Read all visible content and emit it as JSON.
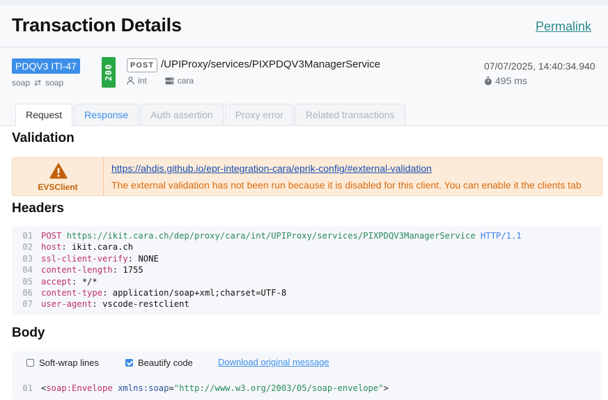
{
  "header": {
    "title": "Transaction Details",
    "permalink": "Permalink"
  },
  "summary": {
    "profile": "PDQV3 ITI-47",
    "proto_in": "soap",
    "proto_arrow": "⇄",
    "proto_out": "soap",
    "status": "200",
    "method": "POST",
    "path": "/UPIProxy/services/PIXPDQV3ManagerService",
    "user": "int",
    "server": "cara",
    "datetime": "07/07/2025, 14:40:34.940",
    "duration": "495 ms",
    "colors": {
      "badge": "#3c8ee8",
      "status_ok": "#28a745"
    }
  },
  "tabs": [
    {
      "label": "Request",
      "state": "active"
    },
    {
      "label": "Response",
      "state": "link"
    },
    {
      "label": "Auth assertion",
      "state": "disabled"
    },
    {
      "label": "Proxy error",
      "state": "disabled"
    },
    {
      "label": "Related transactions",
      "state": "disabled"
    }
  ],
  "validation": {
    "title": "Validation",
    "source": "EVSClient",
    "url": "https://ahdis.github.io/epr-integration-cara/eprik-config/#external-validation",
    "message": "The external validation has not been run because it is disabled for this client. You can enable it the clients tab"
  },
  "headers": {
    "title": "Headers",
    "lines": [
      {
        "n": "01",
        "method": "POST",
        "url": "https://ikit.cara.ch/dep/proxy/cara/int/UPIProxy/services/PIXPDQV3ManagerService",
        "proto": "HTTP/1.1"
      },
      {
        "n": "02",
        "key": "host",
        "value": "ikit.cara.ch"
      },
      {
        "n": "03",
        "key": "ssl-client-verify",
        "value": "NONE"
      },
      {
        "n": "04",
        "key": "content-length",
        "value": "1755"
      },
      {
        "n": "05",
        "key": "accept",
        "value": "*/*"
      },
      {
        "n": "06",
        "key": "content-type",
        "value": "application/soap+xml;charset=UTF-8"
      },
      {
        "n": "07",
        "key": "user-agent",
        "value": "vscode-restclient"
      }
    ]
  },
  "body": {
    "title": "Body",
    "soft_wrap_label": "Soft-wrap lines",
    "soft_wrap_checked": false,
    "beautify_label": "Beautify code",
    "beautify_checked": true,
    "download_label": "Download original message",
    "line1": {
      "n": "01",
      "tag": "soap:Envelope",
      "attr": "xmlns:soap",
      "value": "\"http://www.w3.org/2003/05/soap-envelope\""
    }
  }
}
